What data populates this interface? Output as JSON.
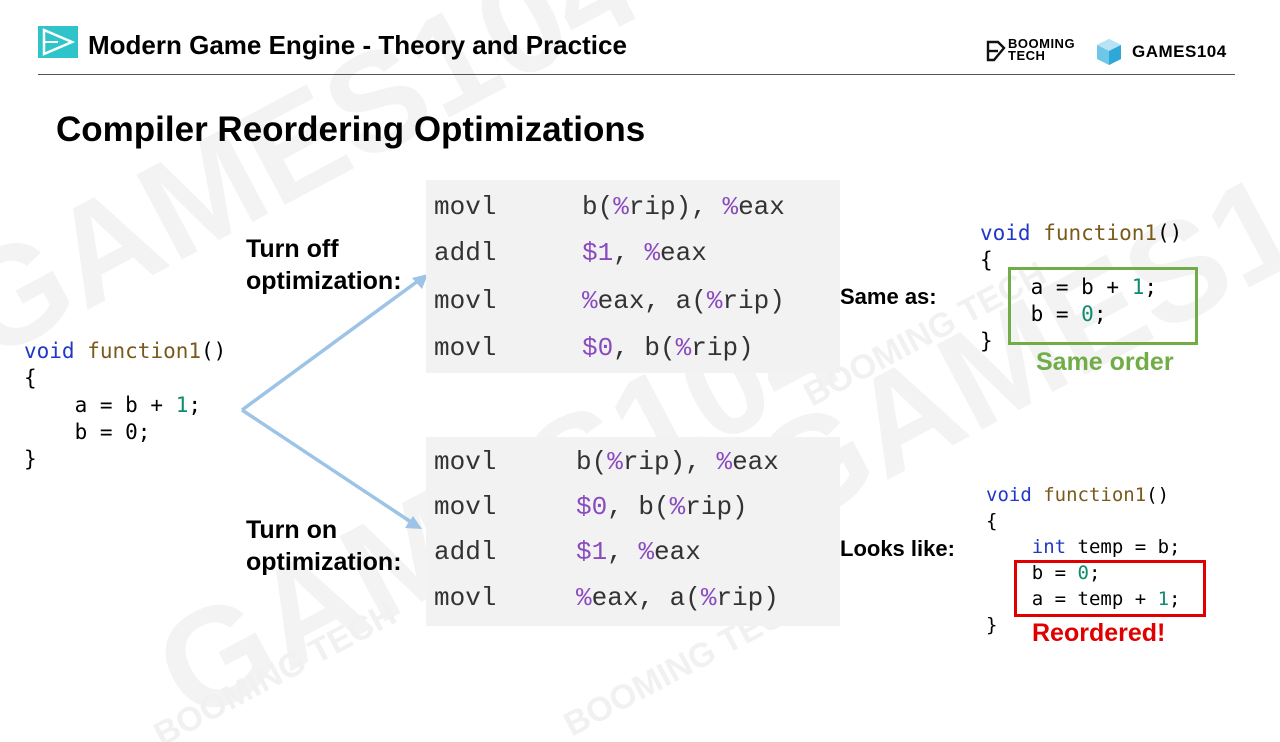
{
  "header": {
    "title": "Modern Game Engine - Theory and Practice",
    "brand_booming": "BOOMING",
    "brand_tech": "TECH",
    "brand_games": "GAMES104"
  },
  "slide": {
    "title": "Compiler Reordering Optimizations"
  },
  "source_code": {
    "lines": [
      "void function1()",
      "{",
      "    a = b + 1;",
      "    b = 0;",
      "}"
    ]
  },
  "labels": {
    "turn_off": "Turn off",
    "turn_off_2": "optimization:",
    "turn_on": "Turn on",
    "turn_on_2": "optimization:",
    "same_as": "Same as:",
    "looks_like": "Looks like:",
    "same_order": "Same order",
    "reordered": "Reordered!"
  },
  "asm_unoptimized": [
    {
      "op": "movl",
      "args": "b(%rip), %eax"
    },
    {
      "op": "addl",
      "args": "$1, %eax"
    },
    {
      "op": "movl",
      "args": "%eax, a(%rip)"
    },
    {
      "op": "movl",
      "args": "$0, b(%rip)"
    }
  ],
  "asm_optimized": [
    {
      "op": "movl",
      "args": "b(%rip), %eax"
    },
    {
      "op": "movl",
      "args": "$0, b(%rip)"
    },
    {
      "op": "addl",
      "args": "$1, %eax"
    },
    {
      "op": "movl",
      "args": "%eax, a(%rip)"
    }
  ],
  "same_as_code": {
    "lines": [
      "void function1()",
      "{",
      "    a = b + 1;",
      "    b = 0;",
      "}"
    ]
  },
  "looks_like_code": {
    "lines": [
      "void function1()",
      "{",
      "    int temp = b;",
      "    b = 0;",
      "    a = temp + 1;",
      "}"
    ]
  },
  "watermark": {
    "games_text": "GAMES104",
    "booming_text": "BOOMING TECH"
  },
  "colors": {
    "keyword": "#1f38c7",
    "function_name": "#7a5a1c",
    "number": "#0f8a6e",
    "same_order_green": "#70ad47",
    "reordered_red": "#e00000",
    "arrow_blue": "#9dc3e6",
    "asm_bg": "#f2f2f2",
    "logo_teal": "#2ec4c9"
  }
}
